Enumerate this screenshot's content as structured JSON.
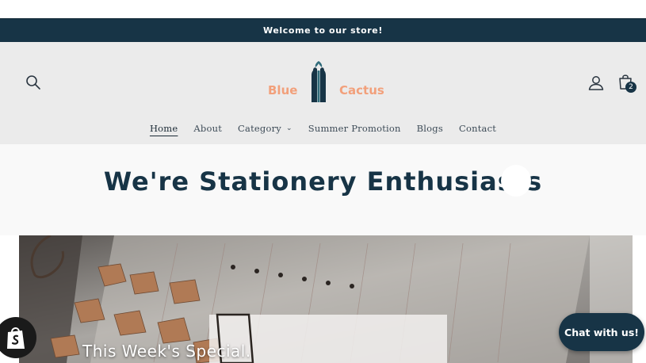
{
  "announcement": {
    "text": "Welcome to our store!"
  },
  "header": {
    "logo": {
      "word1": "Blue",
      "word2": "Cactus"
    },
    "cart_count": "2",
    "icons": {
      "search": "search-icon",
      "account": "user-icon",
      "cart": "shopping-bag-icon"
    }
  },
  "nav": {
    "items": [
      {
        "label": "Home",
        "active": true
      },
      {
        "label": "About"
      },
      {
        "label": "Category",
        "has_dropdown": true
      },
      {
        "label": "Summer Promotion"
      },
      {
        "label": "Blogs"
      },
      {
        "label": "Contact"
      }
    ]
  },
  "main": {
    "title": "We're Stationery Enthusiasts"
  },
  "hero": {
    "caption": "This Week's Special."
  },
  "chat": {
    "label": "Chat with us!"
  },
  "colors": {
    "brand_dark": "#173446",
    "brand_accent": "#f2a07b",
    "header_bg": "#ebebeb"
  }
}
